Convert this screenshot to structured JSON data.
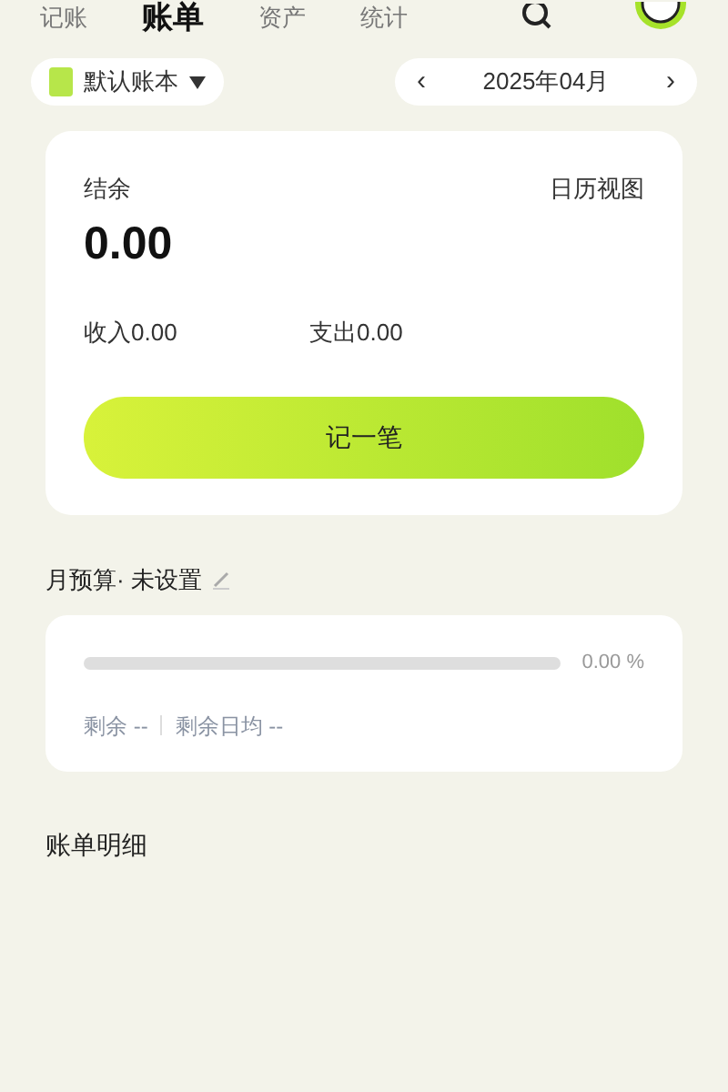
{
  "tabs": [
    {
      "label": "记账",
      "selected": false
    },
    {
      "label": "账单",
      "selected": true
    },
    {
      "label": "资产",
      "selected": false
    },
    {
      "label": "统计",
      "selected": false
    }
  ],
  "book": {
    "label": "默认账本"
  },
  "month": {
    "label": "2025年04月",
    "prev": "‹",
    "next": "›"
  },
  "summary": {
    "balance_label": "结余",
    "calendar_link": "日历视图",
    "balance": "0.00",
    "income": "收入0.00",
    "expense": "支出0.00",
    "action": "记一笔"
  },
  "budget": {
    "title": "月预算· 未设置",
    "level": 0,
    "percent": "0.00 %",
    "remaining": "剩余 --",
    "daily": "剩余日均 --"
  },
  "details": {
    "title": "账单明细"
  }
}
